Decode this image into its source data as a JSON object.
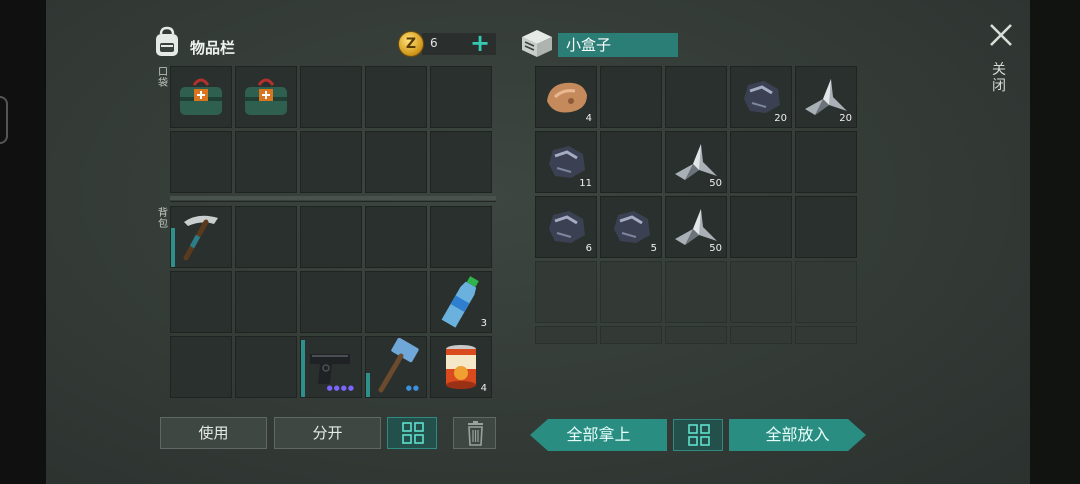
{
  "inventory": {
    "title": "物品栏",
    "coins": "6",
    "pocket_label": "口袋",
    "backpack_label": "背包"
  },
  "container": {
    "name": "小盒子"
  },
  "pocket_slots": [
    {
      "item": "medkit-icon"
    },
    {
      "item": "medkit-icon"
    },
    {},
    {},
    {},
    {},
    {},
    {},
    {},
    {}
  ],
  "backpack_slots": [
    {
      "item": "pickaxe-icon",
      "durability": 0.65
    },
    {},
    {},
    {},
    {},
    {},
    {},
    {},
    {},
    {
      "item": "water-bottle-icon",
      "qty": "3"
    },
    {},
    {},
    {
      "item": "pistol-icon",
      "durability": 0.95,
      "dots": "●●●●"
    },
    {
      "item": "sledgehammer-icon",
      "durability": 0.4,
      "dots": "●●",
      "dots_blue": true
    },
    {
      "item": "canned-food-icon",
      "qty": "4"
    }
  ],
  "container_slots": [
    {
      "item": "copper-ore-icon",
      "qty": "4"
    },
    {},
    {},
    {
      "item": "iron-ore-icon",
      "qty": "20"
    },
    {
      "item": "scrap-metal-icon",
      "qty": "20"
    },
    {
      "item": "iron-ore-icon",
      "qty": "11"
    },
    {},
    {
      "item": "scrap-metal-icon",
      "qty": "50"
    },
    {},
    {},
    {
      "item": "iron-ore-icon",
      "qty": "6"
    },
    {
      "item": "iron-ore-icon",
      "qty": "5"
    },
    {
      "item": "scrap-metal-icon",
      "qty": "50"
    },
    {},
    {}
  ],
  "buttons": {
    "use": "使用",
    "split": "分开",
    "take_all": "全部拿上",
    "put_all": "全部放入",
    "close": "关闭"
  },
  "colors": {
    "accent": "#2a8d82",
    "slot": "#2a302d",
    "background": "#3a423e"
  }
}
